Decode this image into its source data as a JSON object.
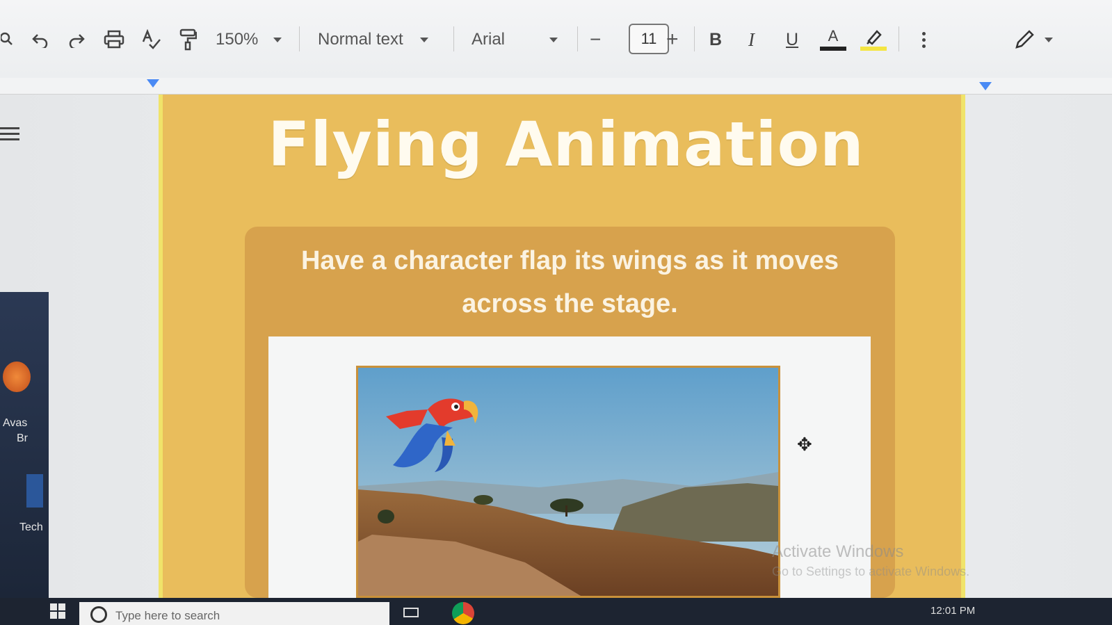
{
  "toolbar": {
    "zoom": "150%",
    "style": "Normal text",
    "font": "Arial",
    "font_size": "11",
    "minus": "−",
    "plus": "+",
    "bold": "B",
    "italic": "I",
    "underline": "U",
    "text_color_letter": "A"
  },
  "document": {
    "title": "Flying Animation",
    "subtitle": "Have a character flap its wings as it  moves across the stage."
  },
  "watermark": {
    "line1": "Activate Windows",
    "line2": "Go to Settings to activate Windows."
  },
  "desktop": {
    "label1": "Avas",
    "label1b": "Br",
    "label2": "Tech"
  },
  "taskbar": {
    "search_placeholder": "Type here to search",
    "clock": "12:01 PM"
  },
  "colors": {
    "page_bg": "#e9bd5c",
    "card_bg": "#d7a24d",
    "title_color": "#fffbef",
    "highlight": "#f4e542"
  }
}
